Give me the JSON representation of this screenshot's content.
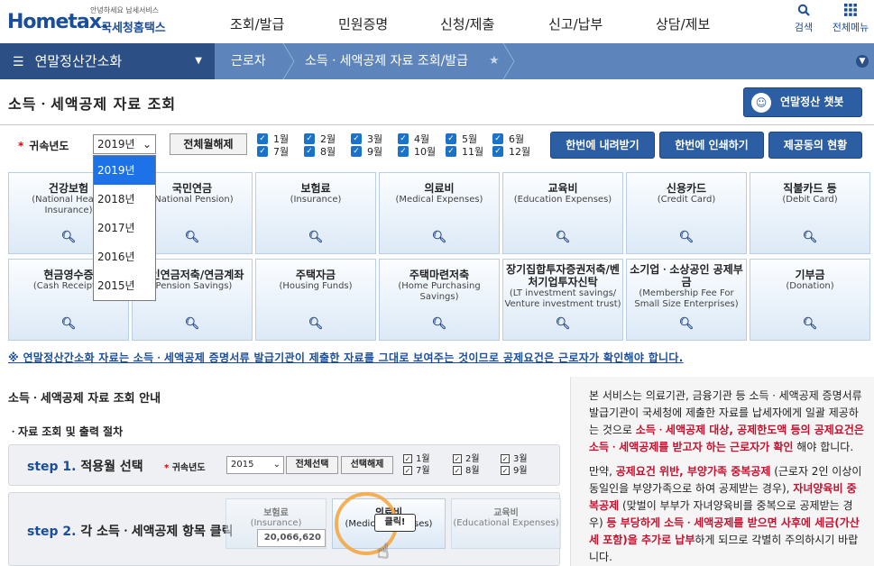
{
  "header": {
    "logo_small": "안녕하세요 납세서비스",
    "logo_main": "Hometax.",
    "logo_kr": "국세청홈택스",
    "gnb": [
      "조회/발급",
      "민원증명",
      "신청/제출",
      "신고/납부",
      "상담/제보"
    ],
    "search_label": "검색",
    "allmenu_label": "전체메뉴"
  },
  "nav": {
    "menu_label": "연말정산간소화",
    "crumb1": "근로자",
    "crumb2": "소득ㆍ세액공제 자료 조회/발급"
  },
  "page": {
    "title": "소득ㆍ세액공제 자료 조회",
    "chatbot_label": "연말정산 챗봇"
  },
  "filter": {
    "year_label": "귀속년도",
    "year_value": "2019년",
    "all_clear": "전체월해제",
    "months": [
      "1월",
      "2월",
      "3월",
      "4월",
      "5월",
      "6월",
      "7월",
      "8월",
      "9월",
      "10월",
      "11월",
      "12월"
    ],
    "btn_download": "한번에 내려받기",
    "btn_print": "한번에 인쇄하기",
    "btn_status": "제공동의 현황",
    "year_options": [
      "2019년",
      "2018년",
      "2017년",
      "2016년",
      "2015년"
    ]
  },
  "tiles": [
    {
      "title": "건강보험",
      "sub": "(National Health Insurance)"
    },
    {
      "title": "국민연금",
      "sub": "(National Pension)"
    },
    {
      "title": "보험료",
      "sub": "(Insurance)"
    },
    {
      "title": "의료비",
      "sub": "(Medical Expenses)"
    },
    {
      "title": "교육비",
      "sub": "(Education Expenses)"
    },
    {
      "title": "신용카드",
      "sub": "(Credit Card)"
    },
    {
      "title": "직불카드 등",
      "sub": "(Debit Card)"
    },
    {
      "title": "현금영수증",
      "sub": "(Cash Receipts)"
    },
    {
      "title": "개인연금저축/연금계좌",
      "sub": "(Pension Savings)"
    },
    {
      "title": "주택자금",
      "sub": "(Housing Funds)"
    },
    {
      "title": "주택마련저축",
      "sub": "(Home Purchasing Savings)"
    },
    {
      "title": "장기집합투자증권저축/벤처기업투자신탁",
      "sub": "(LT investment savings/ Venture investment trust)"
    },
    {
      "title": "소기업ㆍ소상공인 공제부금",
      "sub": "(Membership Fee For Small Size Enterprises)"
    },
    {
      "title": "기부금",
      "sub": "(Donation)"
    }
  ],
  "notice": "※ 연말정산간소화 자료는 소득ㆍ세액공제 증명서류 발급기관이 제출한 자료를 그대로 보여주는 것이므로 공제요건은 근로자가 확인해야 합니다.",
  "guide": {
    "section_title": "소득ㆍ세액공제 자료 조회 안내",
    "procedure_title": "자료 조회 및 출력 절차",
    "step1_num": "step 1.",
    "step1_text": "적용월 선택",
    "step1_year_label": "귀속년도",
    "step1_year_value": "2015",
    "step1_select_all": "전체선택",
    "step1_clear": "선택해제",
    "step1_months": [
      "1월",
      "2월",
      "3월",
      "7월",
      "8월",
      "9월"
    ],
    "step2_num": "step 2.",
    "step2_text": "각 소득ㆍ세액공제 항목 클릭",
    "step2_tile1_title": "보험료",
    "step2_tile1_sub": "(Insurance)",
    "step2_amount": "20,066,620",
    "step2_tile2_title": "의료비",
    "step2_tile2_sub": "(Medical Expenses)",
    "step2_tile3_title": "교육비",
    "step2_tile3_sub": "(Educational Expenses)",
    "click_label": "클릭!"
  },
  "info": {
    "p1_a": "본 서비스는 의료기관, 금융기관 등 소득ㆍ세액공제 증명서류 발급기관이 국세청에 제출한 자료를 납세자에게 일괄 제공하는 것으로 ",
    "p1_b": "소득ㆍ세액공제 대상, 공제한도액 등의 공제요건은 소득ㆍ세액공제를 받고자 하는 근로자가 확인",
    "p1_c": " 해야 합니다.",
    "p2_a": "만약, ",
    "p2_b": "공제요건 위반, 부양가족 중복공제",
    "p2_c": " (근로자 2인 이상이 동일인을 부양가족으로 하여 공제받는 경우), ",
    "p2_d": "자녀양육비 중복공제",
    "p2_e": " (맞벌이 부부가 자녀양육비를 중복으로 공제받는 경우) ",
    "p2_f": "등 부당하게 소득ㆍ세액공제를 받으면 사후에 세금(가산세 포함)을 추가로 납부",
    "p2_g": "하게 되므로 각별히 주의하시기 바랍니다."
  }
}
